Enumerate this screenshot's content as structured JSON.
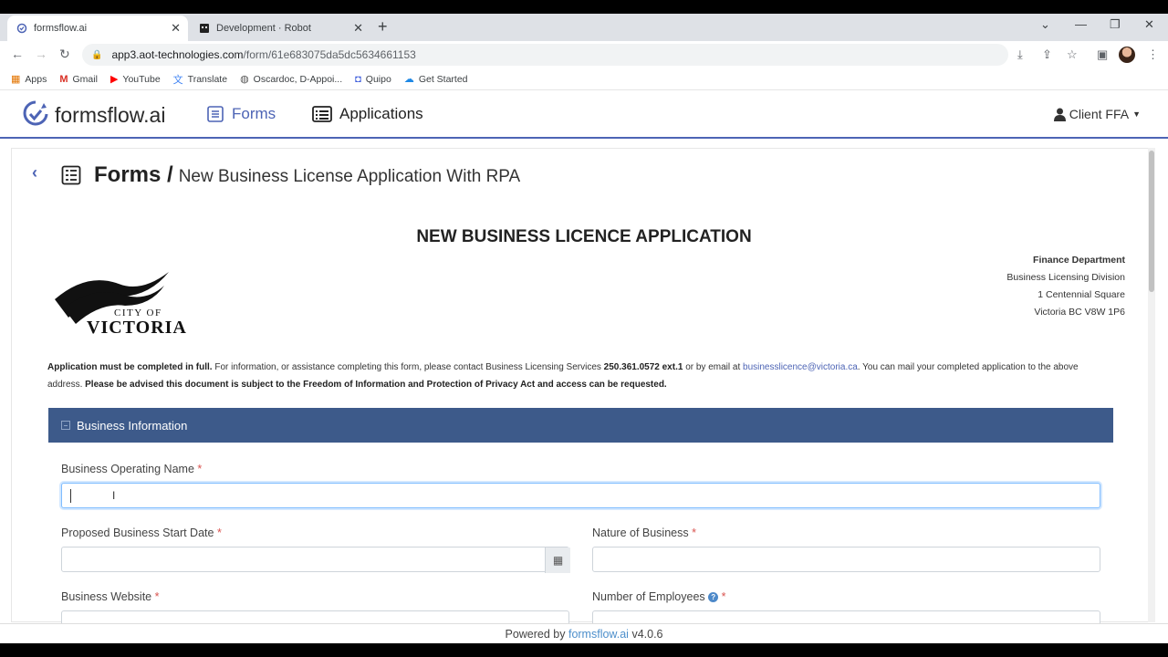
{
  "browser": {
    "tabs": [
      {
        "title": "formsflow.ai",
        "active": true
      },
      {
        "title": "Development · Robot",
        "active": false
      }
    ],
    "new_tab_icon": "plus-icon",
    "url_host": "app3.aot-technologies.com",
    "url_path": "/form/61e683075da5dc5634661153",
    "bookmarks": [
      {
        "label": "Apps",
        "icon": "apps-grid-icon"
      },
      {
        "label": "Gmail",
        "icon": "gmail-icon"
      },
      {
        "label": "YouTube",
        "icon": "youtube-icon"
      },
      {
        "label": "Translate",
        "icon": "translate-icon"
      },
      {
        "label": "Oscardoc, D-Appoi...",
        "icon": "globe-icon"
      },
      {
        "label": "Quipo",
        "icon": "quipo-icon"
      },
      {
        "label": "Get Started",
        "icon": "get-started-icon"
      }
    ]
  },
  "header": {
    "brand": "formsflow.ai",
    "nav": [
      {
        "label": "Forms",
        "active": true
      },
      {
        "label": "Applications",
        "active": false
      }
    ],
    "user": "Client FFA"
  },
  "breadcrumb": {
    "root": "Forms /",
    "current": "New Business License Application With RPA"
  },
  "form": {
    "title": "NEW BUSINESS LICENCE APPLICATION",
    "logo_text_top": "CITY OF",
    "logo_text_bottom": "VICTORIA",
    "department": [
      "Finance Department",
      "Business Licensing Division",
      "1 Centennial Square",
      "Victoria BC V8W 1P6"
    ],
    "notice": {
      "bold1": "Application must be completed in full.",
      "text1": " For information, or assistance completing this form, please contact Business Licensing Services ",
      "phone": "250.361.0572 ext.1",
      "text2": " or by email at ",
      "email": "businesslicence@victoria.ca",
      "text3": ". You can mail your completed application to the above address. ",
      "bold2": "Please be advised this document is subject to the Freedom of Information and Protection of Privacy Act and access can be requested."
    },
    "section_title": "Business Information",
    "fields": {
      "operating_name": {
        "label": "Business Operating Name",
        "value": ""
      },
      "start_date": {
        "label": "Proposed Business Start Date",
        "value": ""
      },
      "nature": {
        "label": "Nature of Business",
        "value": ""
      },
      "website": {
        "label": "Business Website",
        "value": ""
      },
      "employees": {
        "label": "Number of Employees",
        "value": ""
      }
    },
    "required_mark": "*"
  },
  "footer": {
    "prefix": "Powered by ",
    "link": "formsflow.ai",
    "version": " v4.0.6"
  },
  "colors": {
    "accent": "#4d64b5",
    "panel_header": "#3d5a8a",
    "required": "#d9534f"
  }
}
